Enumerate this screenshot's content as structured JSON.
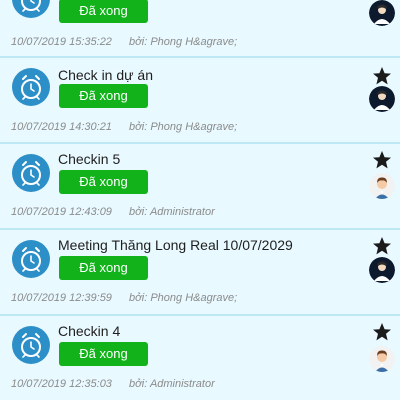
{
  "colors": {
    "card_bg": "#e8f9ff",
    "button_green": "#12b31a",
    "alarm_blue": "#2c8fc8",
    "meta_gray": "#8b8b8b"
  },
  "tasks": [
    {
      "title": "",
      "button_label": "Đã xong",
      "timestamp": "10/07/2019 15:35:22",
      "by_label": "bởi:",
      "author": "Phong H&agrave;",
      "starred": false,
      "avatar": "dark-avatar-icon"
    },
    {
      "title": "Check in dự án",
      "button_label": "Đã xong",
      "timestamp": "10/07/2019 14:30:21",
      "by_label": "bởi:",
      "author": "Phong H&agrave;",
      "starred": true,
      "avatar": "dark-avatar-icon"
    },
    {
      "title": "Checkin 5",
      "button_label": "Đã xong",
      "timestamp": "10/07/2019 12:43:09",
      "by_label": "bởi:",
      "author": "Administrator",
      "starred": true,
      "avatar": "person-avatar-icon"
    },
    {
      "title": "Meeting Thăng Long Real 10/07/2029",
      "button_label": "Đã xong",
      "timestamp": "10/07/2019 12:39:59",
      "by_label": "bởi:",
      "author": "Phong H&agrave;",
      "starred": true,
      "avatar": "dark-avatar-icon"
    },
    {
      "title": "Checkin 4",
      "button_label": "Đã xong",
      "timestamp": "10/07/2019 12:35:03",
      "by_label": "bởi:",
      "author": "Administrator",
      "starred": true,
      "avatar": "person-avatar-icon"
    }
  ]
}
